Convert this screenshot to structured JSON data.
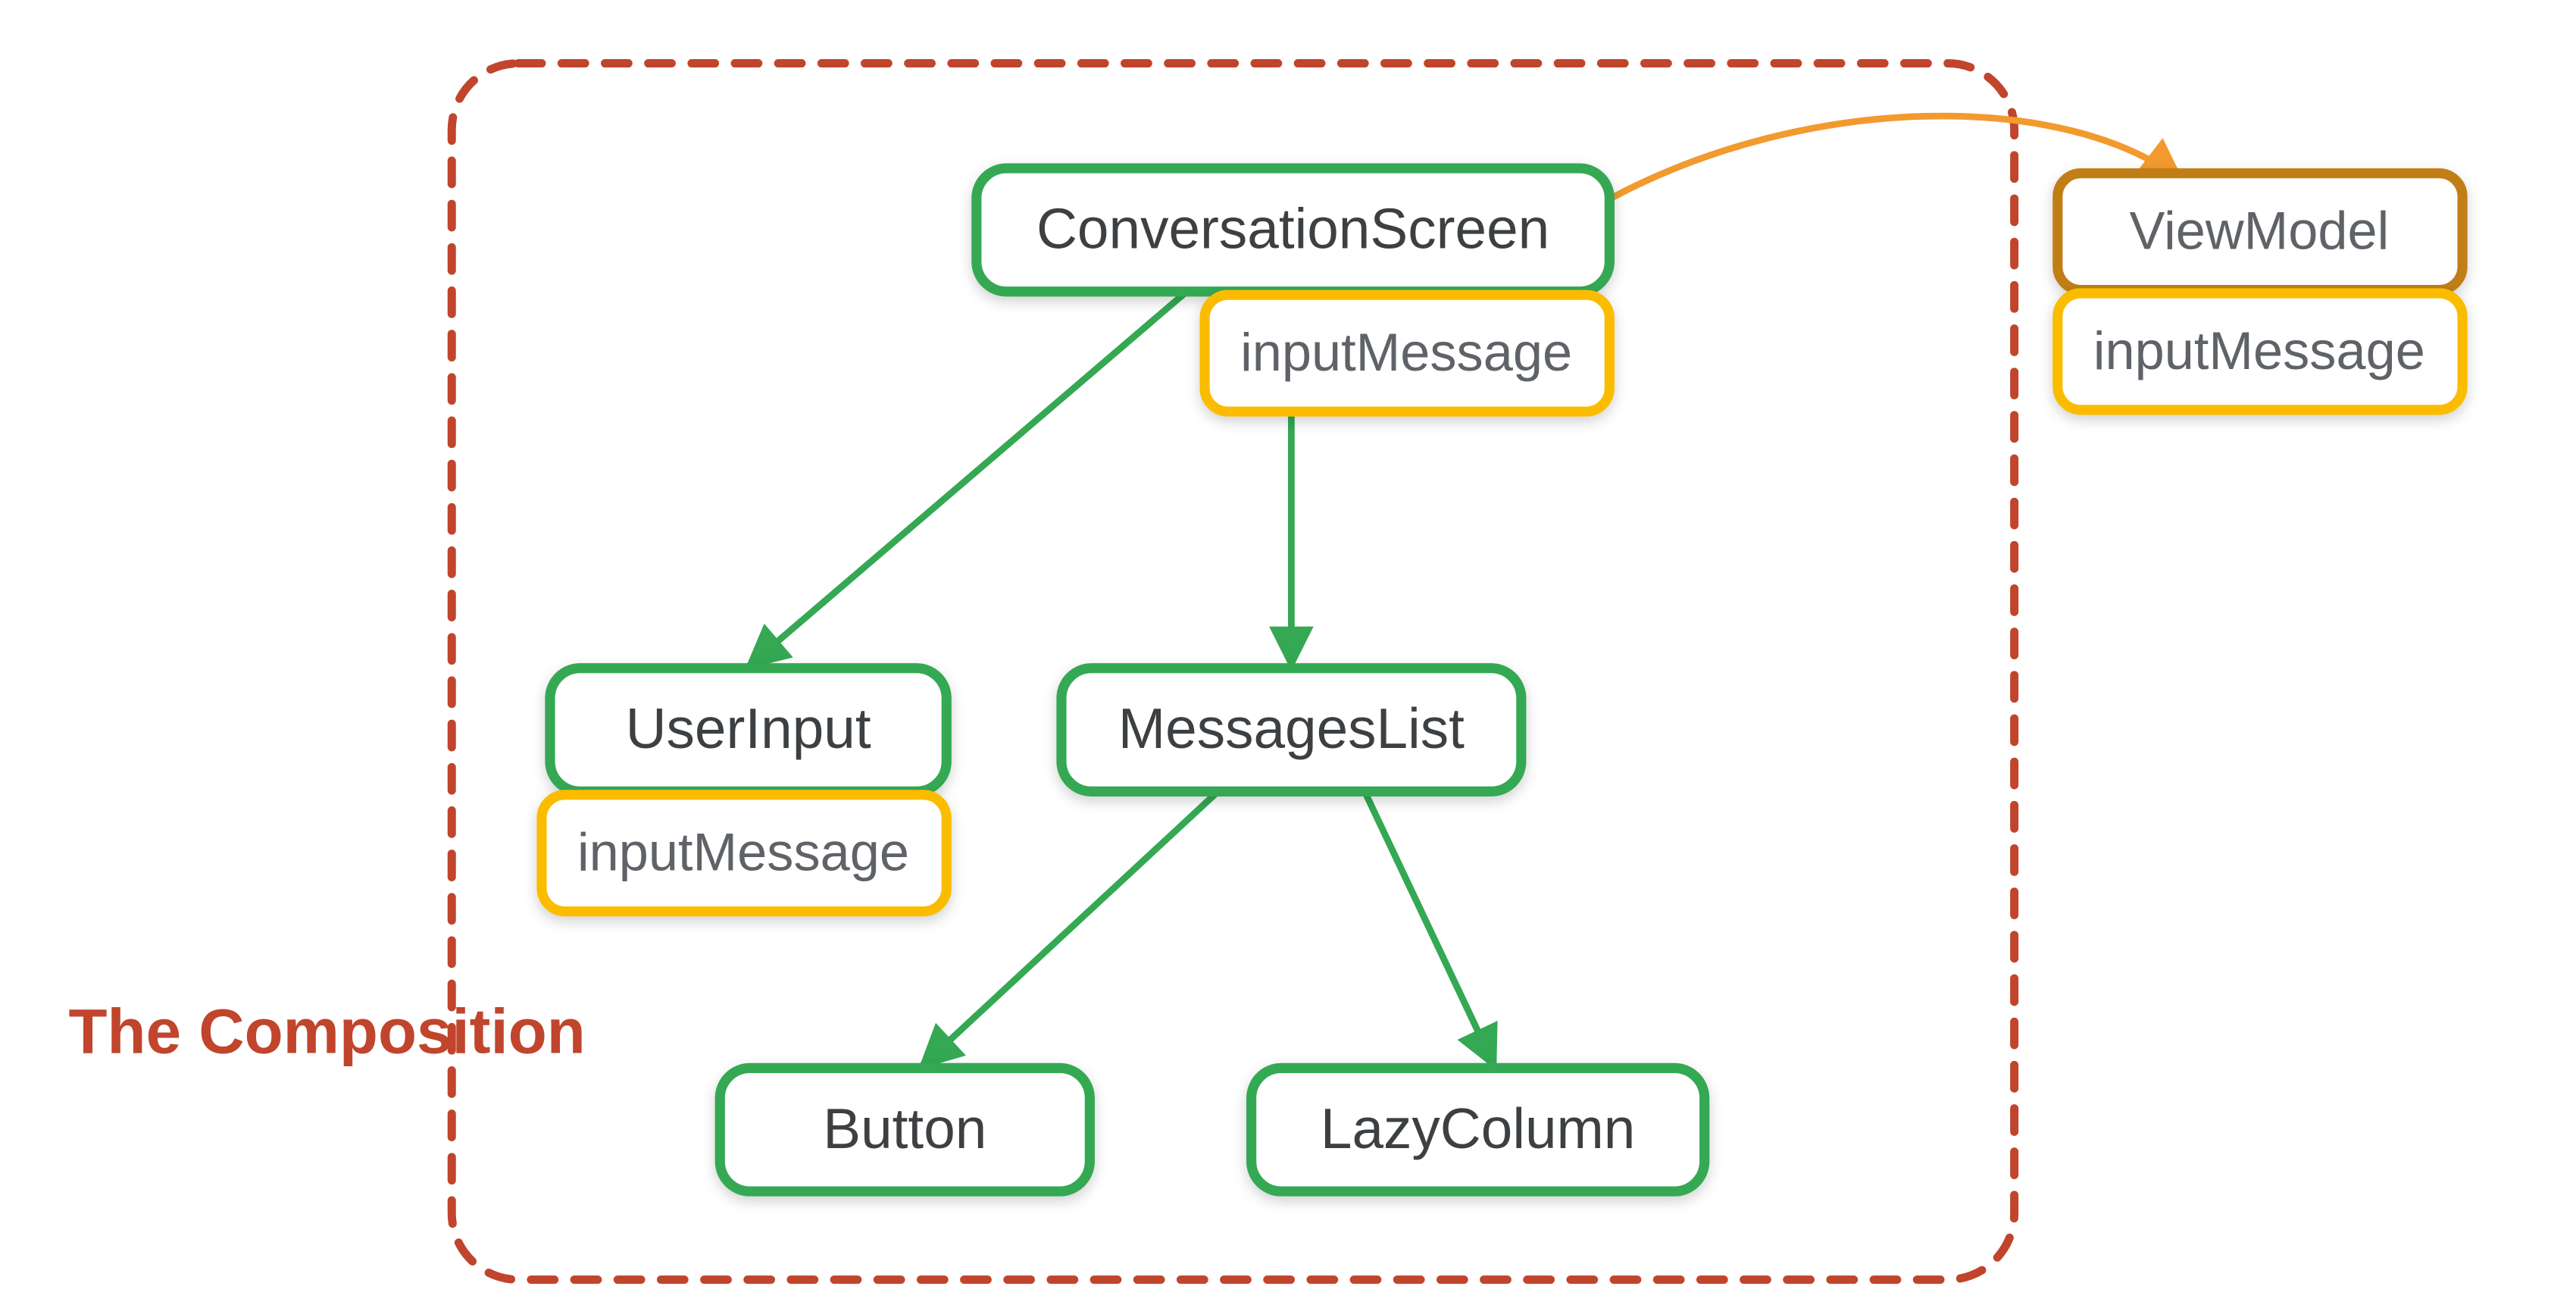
{
  "title": "The Composition",
  "colors": {
    "composition_border": "#c0452c",
    "node_green": "#34a853",
    "node_amber": "#fbbc04",
    "node_amber_dark": "#c17e17",
    "edge_orange": "#f29a2e",
    "text_primary": "#3c4043",
    "text_secondary": "#5f6368"
  },
  "nodes": {
    "conversation_screen": {
      "label": "ConversationScreen",
      "state": "inputMessage"
    },
    "user_input": {
      "label": "UserInput",
      "state": "inputMessage"
    },
    "messages_list": {
      "label": "MessagesList"
    },
    "button": {
      "label": "Button"
    },
    "lazy_column": {
      "label": "LazyColumn"
    },
    "view_model": {
      "label": "ViewModel",
      "state": "inputMessage"
    }
  },
  "edges": [
    {
      "from": "conversation_screen",
      "to": "user_input"
    },
    {
      "from": "conversation_screen",
      "to": "messages_list"
    },
    {
      "from": "messages_list",
      "to": "button"
    },
    {
      "from": "messages_list",
      "to": "lazy_column"
    },
    {
      "from": "conversation_screen",
      "to": "view_model",
      "style": "orange-curve"
    }
  ]
}
